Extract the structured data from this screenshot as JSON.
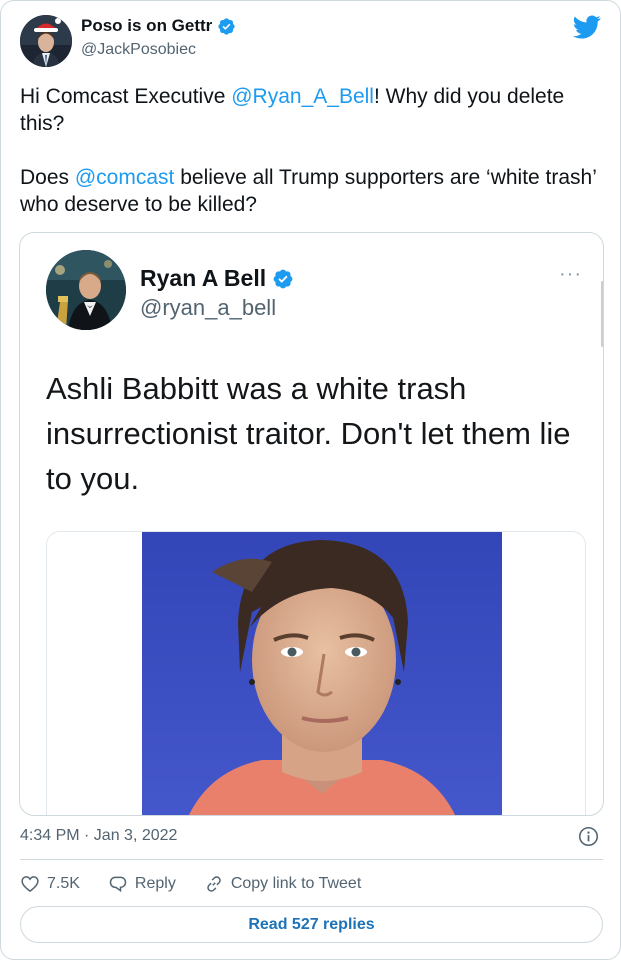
{
  "author": {
    "name": "Poso is on Gettr",
    "handle": "@JackPosobiec"
  },
  "tweet": {
    "paragraph1": [
      {
        "text": "Hi Comcast Executive ",
        "mention": false
      },
      {
        "text": "@Ryan_A_Bell",
        "mention": true
      },
      {
        "text": "! Why did you delete this?",
        "mention": false
      }
    ],
    "paragraph2": [
      {
        "text": "Does ",
        "mention": false
      },
      {
        "text": "@comcast",
        "mention": true
      },
      {
        "text": " believe all Trump supporters are ‘white trash’ who deserve to be killed?",
        "mention": false
      }
    ]
  },
  "embedded": {
    "name": "Ryan A Bell",
    "handle": "@ryan_a_bell",
    "more": "···",
    "text": "Ashli Babbitt was a white trash insurrectionist traitor. Don't let them lie to you."
  },
  "footer": {
    "timestamp": "4:34 PM · Jan 3, 2022",
    "likes": "7.5K",
    "reply_label": "Reply",
    "copy_label": "Copy link to Tweet",
    "read_replies": "Read 527 replies"
  },
  "colors": {
    "link": "#1d9bf0",
    "text": "#0f1419",
    "muted": "#536471",
    "border": "#cfd9de",
    "verified": "#1d9bf0",
    "photo_background": "#3b4fc4"
  },
  "icons": [
    "twitter-bird-icon",
    "verified-badge-icon",
    "info-icon",
    "heart-icon",
    "reply-icon",
    "link-icon",
    "more-icon"
  ]
}
